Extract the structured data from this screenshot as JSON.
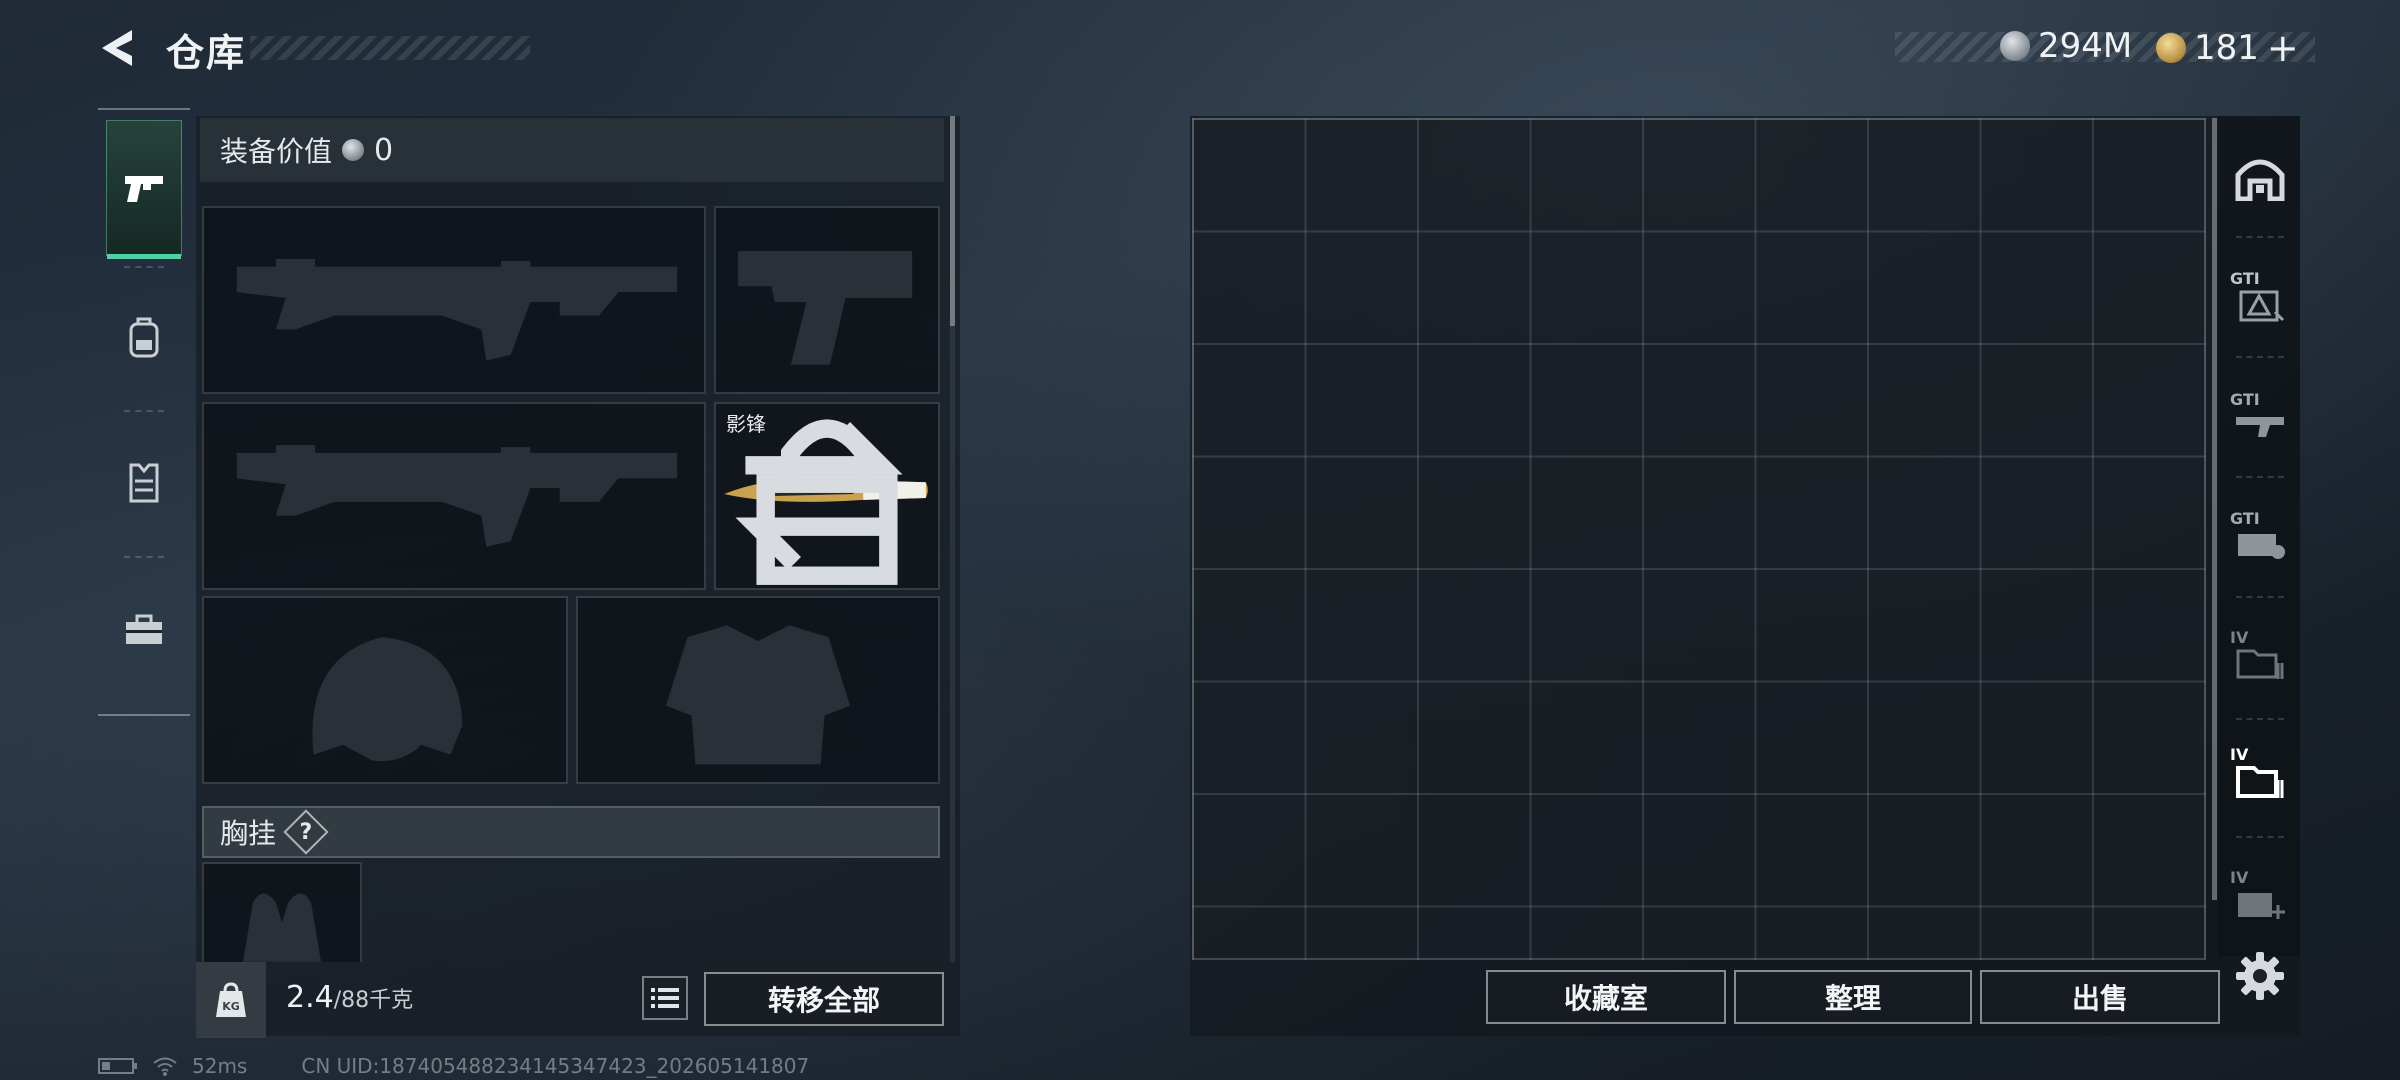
{
  "header": {
    "title": "仓库"
  },
  "currency": {
    "silver_amount": "294M",
    "gold_amount": "181",
    "gold_add_label": "+"
  },
  "sidebar": {
    "tabs": [
      {
        "icon": "pistol-icon",
        "active": true
      },
      {
        "icon": "backpack-icon",
        "active": false
      },
      {
        "icon": "vest-icon",
        "active": false
      },
      {
        "icon": "toolbox-icon",
        "active": false
      }
    ]
  },
  "equipment": {
    "value_label": "装备价值",
    "value": "0",
    "melee_skin_name": "影锋",
    "chest_rig_label": "胸挂",
    "chest_rig_help": "?"
  },
  "inventory": {
    "weight_current": "2.4",
    "weight_max": "/88千克",
    "transfer_all_label": "转移全部"
  },
  "stash": {
    "buttons": {
      "collection_label": "收藏室",
      "organize_label": "整理",
      "sell_label": "出售"
    },
    "side_tabs": [
      {
        "label": "",
        "icon": "home-safe-icon"
      },
      {
        "label": "GTI",
        "icon": "gti-case-icon"
      },
      {
        "label": "GTI",
        "icon": "gti-weapon-case-icon"
      },
      {
        "label": "GTI",
        "icon": "gti-ammo-case-icon"
      },
      {
        "label": "IV",
        "icon": "iv-folder-icon"
      },
      {
        "label": "IV",
        "icon": "iv-folder-active-icon"
      },
      {
        "label": "IV",
        "icon": "iv-medical-case-icon"
      }
    ]
  },
  "footer": {
    "ping": "52ms",
    "uid": "CN UID:1874054882341453474​23_202605141807"
  },
  "colors": {
    "accent": "#4fd0a4",
    "background": "#1f2a36"
  }
}
